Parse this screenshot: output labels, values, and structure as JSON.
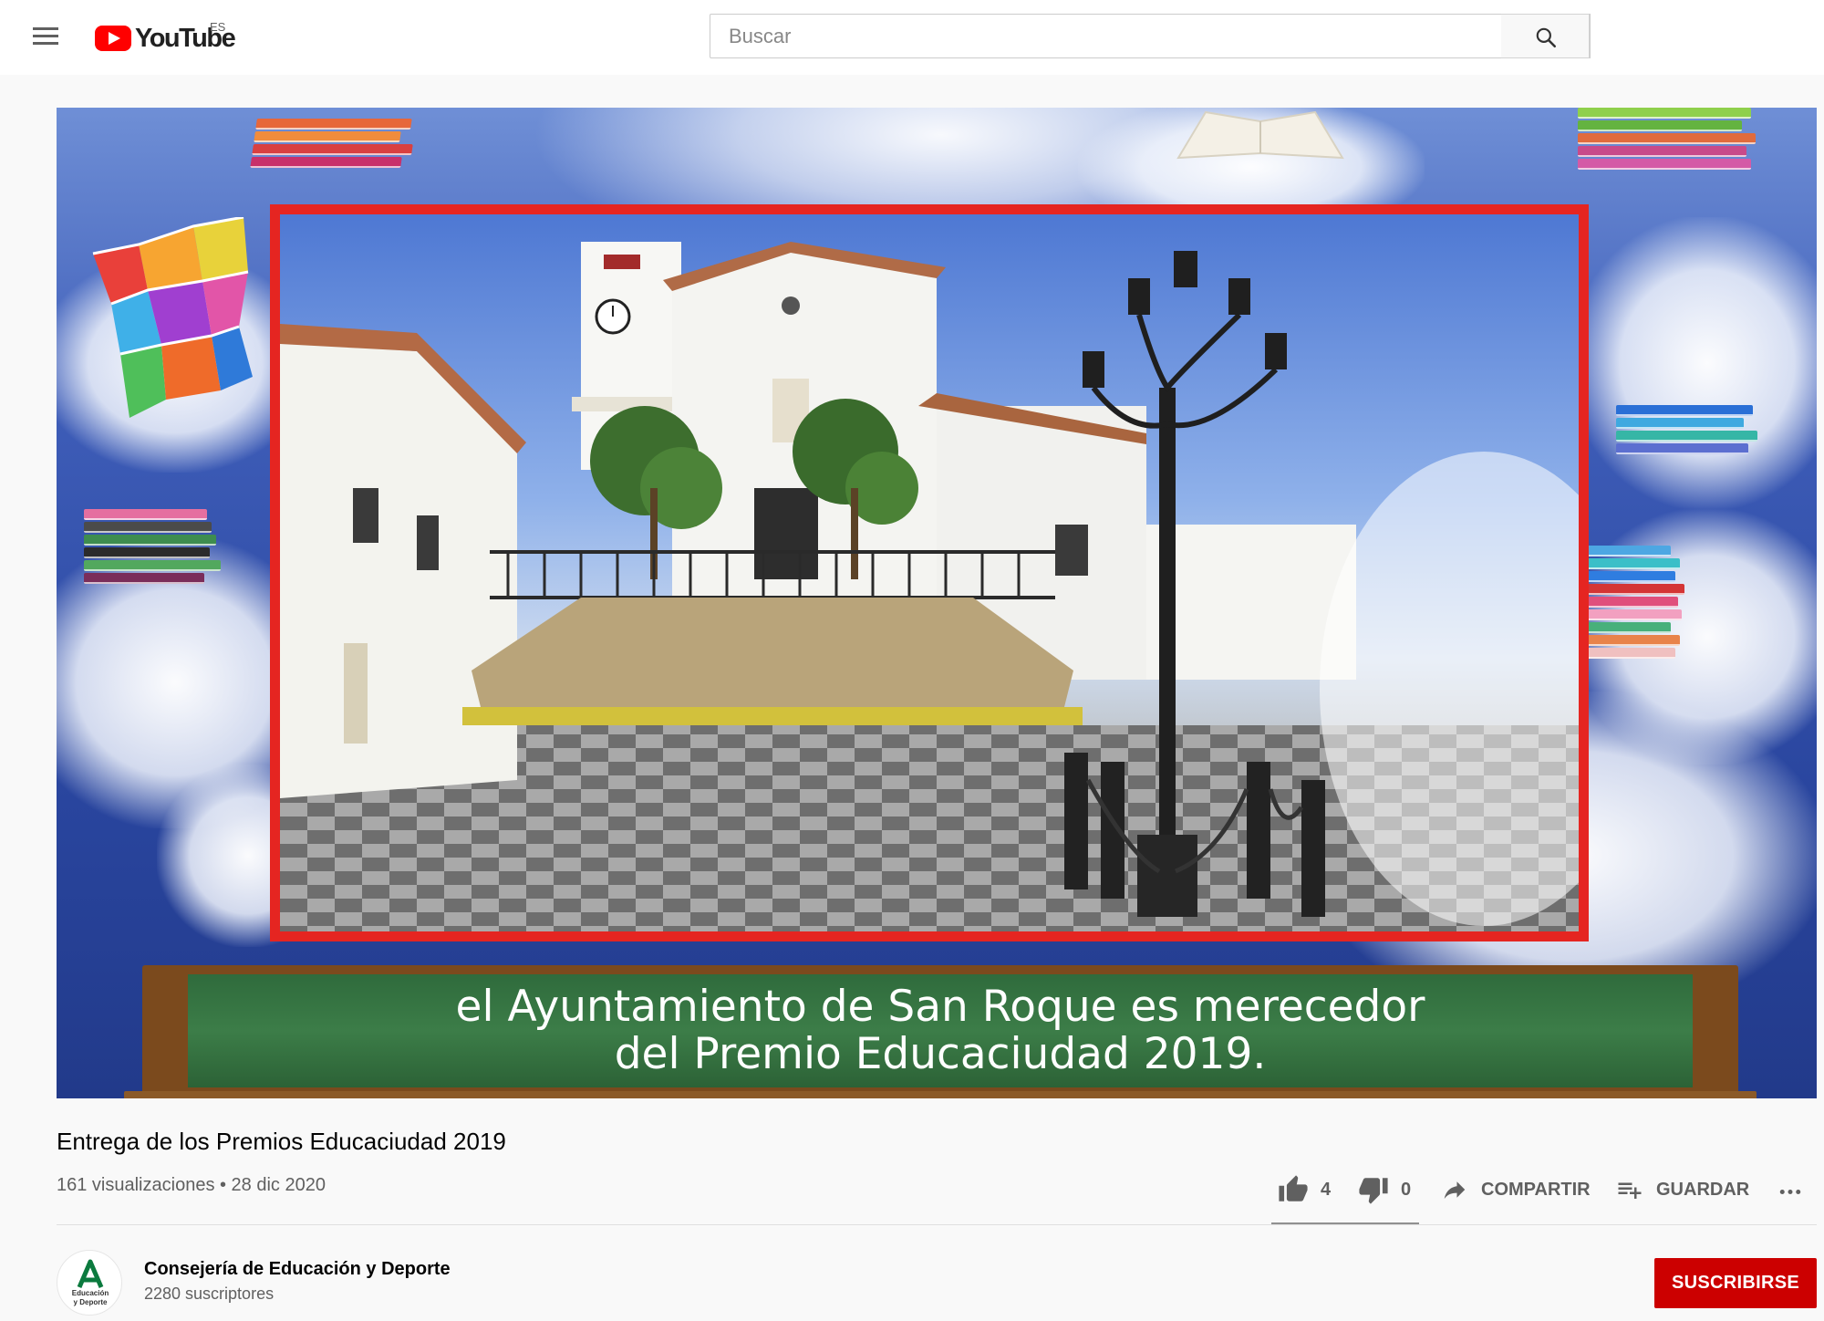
{
  "masthead": {
    "logo_text": "YouTube",
    "country_code": "ES",
    "search_placeholder": "Buscar"
  },
  "video": {
    "caption_line1": "el Ayuntamiento de San Roque es merecedor",
    "caption_line2": "del Premio  Educaciudad 2019.",
    "title": "Entrega de los Premios Educaciudad 2019",
    "meta": "161 visualizaciones • 28 dic 2020"
  },
  "actions": {
    "likes": "4",
    "dislikes": "0",
    "share_label": "COMPARTIR",
    "save_label": "GUARDAR"
  },
  "channel": {
    "name": "Consejería de Educación y Deporte",
    "subscribers": "2280 suscriptores",
    "avatar_text_line1": "Educación",
    "avatar_text_line2": "y Deporte",
    "subscribe_label": "SUSCRIBIRSE"
  },
  "colors": {
    "brand_red": "#ff0000",
    "subscribe_red": "#cc0000",
    "frame_red": "#e52521",
    "chalkboard_green": "#3c7d48",
    "junta_green": "#0b7a3e"
  },
  "icons": [
    "menu-icon",
    "youtube-logo-icon",
    "search-icon",
    "thumb-up-icon",
    "thumb-down-icon",
    "share-icon",
    "playlist-add-icon",
    "more-icon"
  ]
}
